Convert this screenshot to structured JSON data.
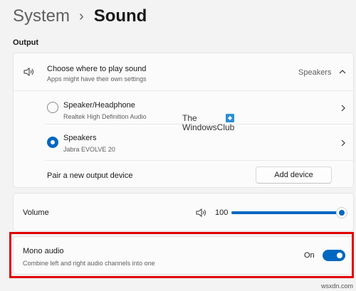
{
  "breadcrumb": {
    "parent": "System",
    "separator": "›",
    "current": "Sound"
  },
  "output": {
    "section_label": "Output",
    "choose": {
      "title": "Choose where to play sound",
      "subtitle": "Apps might have their own settings",
      "current_value": "Speakers",
      "icon": "speaker-icon",
      "expanded": true
    },
    "devices": [
      {
        "name": "Speaker/Headphone",
        "description": "Realtek High Definition Audio",
        "selected": false
      },
      {
        "name": "Speakers",
        "description": "Jabra EVOLVE 20",
        "selected": true
      }
    ],
    "pair": {
      "label": "Pair a new output device",
      "button_label": "Add device"
    }
  },
  "watermark": {
    "line1": "The",
    "line2": "WindowsClub"
  },
  "volume": {
    "label": "Volume",
    "value": "100",
    "level": 1.0,
    "icon": "speaker-icon"
  },
  "mono": {
    "title": "Mono audio",
    "subtitle": "Combine left and right audio channels into one",
    "state_label": "On",
    "enabled": true
  },
  "site_mark": "wsxdn.com",
  "colors": {
    "accent": "#0067c0",
    "highlight": "#e00000",
    "background": "#f3f3f3"
  }
}
